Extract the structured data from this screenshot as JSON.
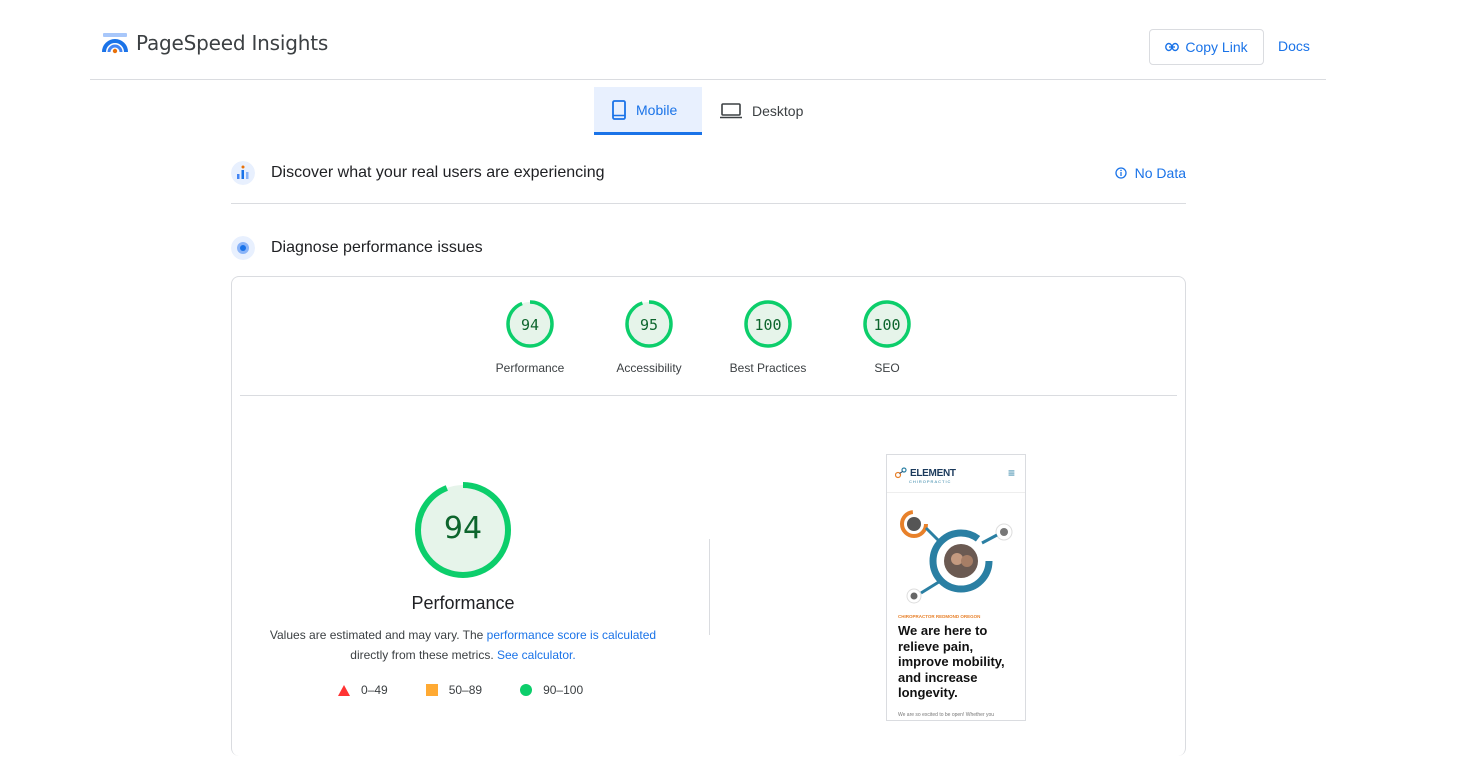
{
  "header": {
    "brand_name": "PageSpeed Insights",
    "copy_link_label": "Copy Link",
    "docs_label": "Docs"
  },
  "tabs": [
    {
      "label": "Mobile",
      "active": true
    },
    {
      "label": "Desktop",
      "active": false
    }
  ],
  "field_data": {
    "title": "Discover what your real users are experiencing",
    "status_label": "No Data"
  },
  "diagnose": {
    "title": "Diagnose performance issues"
  },
  "scores": [
    {
      "label": "Performance",
      "value": 94
    },
    {
      "label": "Accessibility",
      "value": 95
    },
    {
      "label": "Best Practices",
      "value": 100
    },
    {
      "label": "SEO",
      "value": 100
    }
  ],
  "performance": {
    "score": "94",
    "label": "Performance",
    "desc_prefix": "Values are estimated and may vary. The ",
    "desc_link1": "performance score is calculated",
    "desc_middle": " directly from these metrics. ",
    "desc_link2": "See calculator."
  },
  "legend": [
    {
      "range": "0–49",
      "color": "#ff3333",
      "shape": "triangle"
    },
    {
      "range": "50–89",
      "color": "#ffaa33",
      "shape": "square"
    },
    {
      "range": "90–100",
      "color": "#0cce6b",
      "shape": "circle"
    }
  ],
  "thumbnail": {
    "logo_text": "ELEMENT",
    "logo_sub": "CHIROPRACTIC",
    "kicker": "CHIROPRACTOR REDMOND OREGON",
    "headline": "We are here to relieve pain, improve mobility, and increase longevity.",
    "foot": "We are so excited to be open! Whether you"
  },
  "colors": {
    "accent": "#1a73e8",
    "pass_green": "#0cce6b",
    "pass_text": "#0d652d",
    "pass_fill": "#e6f4ea"
  }
}
